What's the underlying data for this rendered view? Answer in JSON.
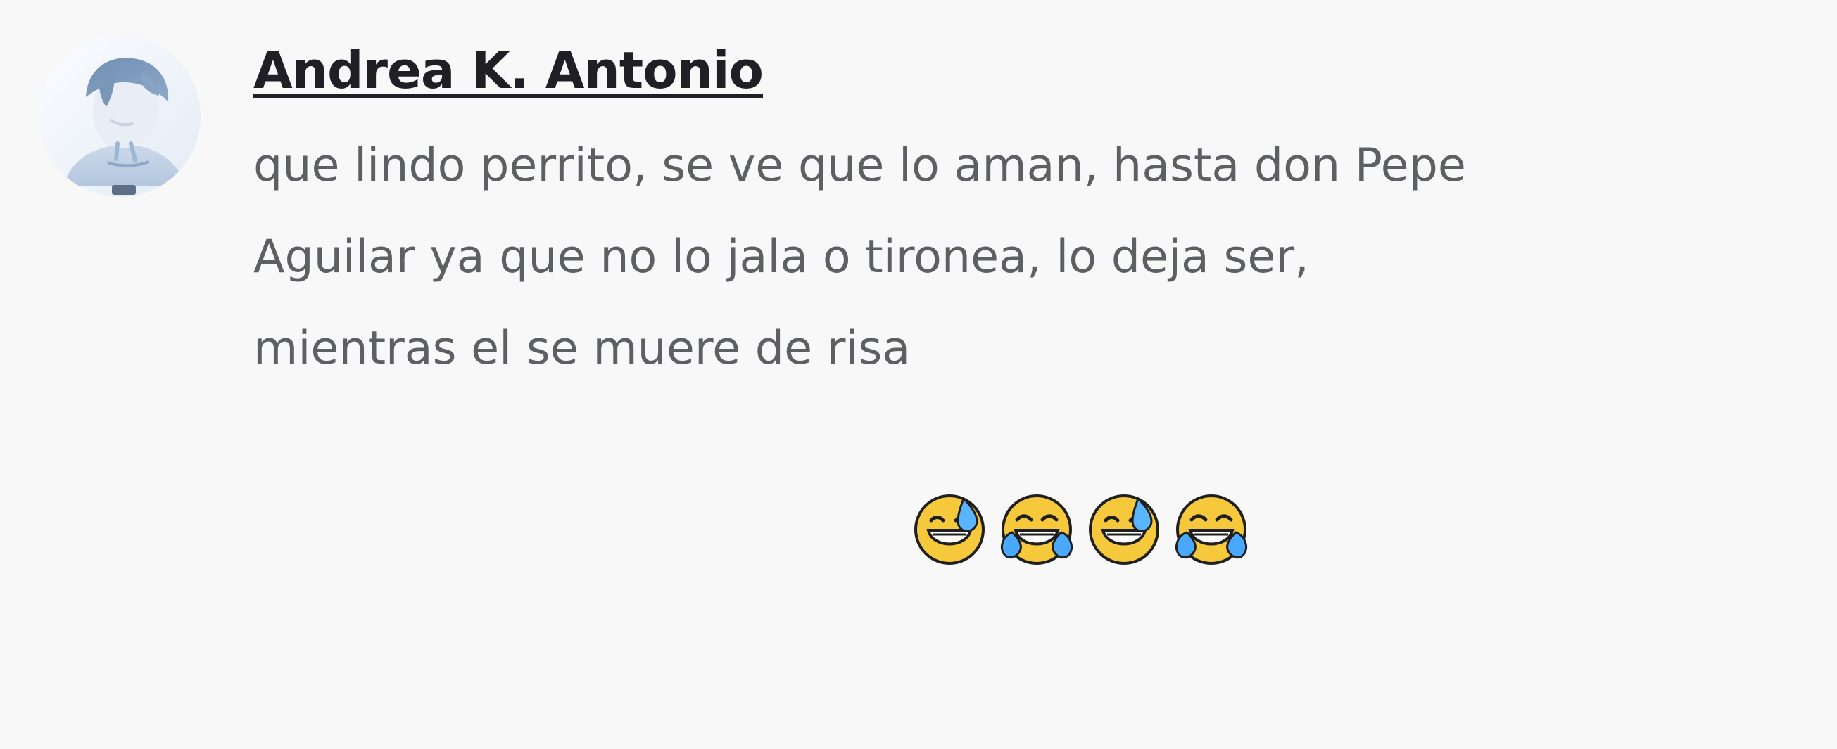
{
  "comment": {
    "author": "Andrea K. Antonio",
    "text_lines": [
      "que lindo perrito, se ve que lo aman, hasta don Pepe",
      "Aguilar ya que no lo jala o tironea, lo deja ser,",
      "mientras el se muere de risa"
    ],
    "emoji_icons": [
      "grinning-face-with-sweat-icon",
      "face-with-tears-of-joy-icon",
      "grinning-face-with-sweat-icon",
      "face-with-tears-of-joy-icon"
    ]
  },
  "colors": {
    "background": "#f8f8f8",
    "author": "#1f1f25",
    "text": "#5e5f63",
    "emoji_face": "#f6c93c"
  }
}
